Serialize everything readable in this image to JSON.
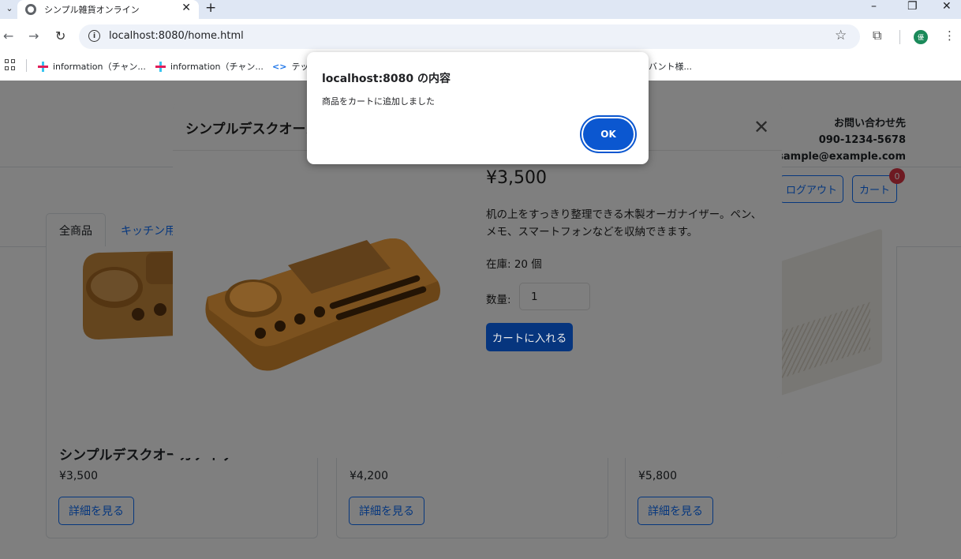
{
  "browser": {
    "tab_title": "シンプル雑貨オンライン",
    "tab_close": "✕",
    "new_tab": "+",
    "url": "localhost:8080/home.html",
    "bookmarks": [
      {
        "label": "information（チャン..."
      },
      {
        "label": "information（チャン..."
      },
      {
        "label": "テック"
      },
      {
        "label": "バント様..."
      }
    ]
  },
  "header": {
    "contact_title": "お問い合わせ先",
    "contact_phone": "090-1234-5678",
    "contact_email": "sample@example.com",
    "logout_label": "ログアウト",
    "cart_label": "カート",
    "cart_count": "0"
  },
  "categories": {
    "all_label": "全商品",
    "kitchen_label": "キッチン用品"
  },
  "products": [
    {
      "name": "シンプルデスクオーガナイザー",
      "price": "¥3,500",
      "button": "詳細を見る"
    },
    {
      "name": "",
      "price": "¥4,200",
      "button": "詳細を見る"
    },
    {
      "name": "",
      "price": "¥5,800",
      "button": "詳細を見る"
    }
  ],
  "modal": {
    "title": "シンプルデスクオーガナイザー",
    "close": "✕",
    "price": "¥3,500",
    "description": "机の上をすっきり整理できる木製オーガナイザー。ペン、メモ、スマートフォンなどを収納できます。",
    "stock": "在庫: 20 個",
    "qty_label": "数量:",
    "qty_value": "1",
    "add_to_cart": "カートに入れる"
  },
  "alert": {
    "title": "localhost:8080 の内容",
    "message": "商品をカートに追加しました",
    "ok_label": "OK"
  },
  "colors": {
    "primary": "#0d6efd",
    "danger": "#dc3545",
    "dialog_button": "#0b57d0"
  }
}
